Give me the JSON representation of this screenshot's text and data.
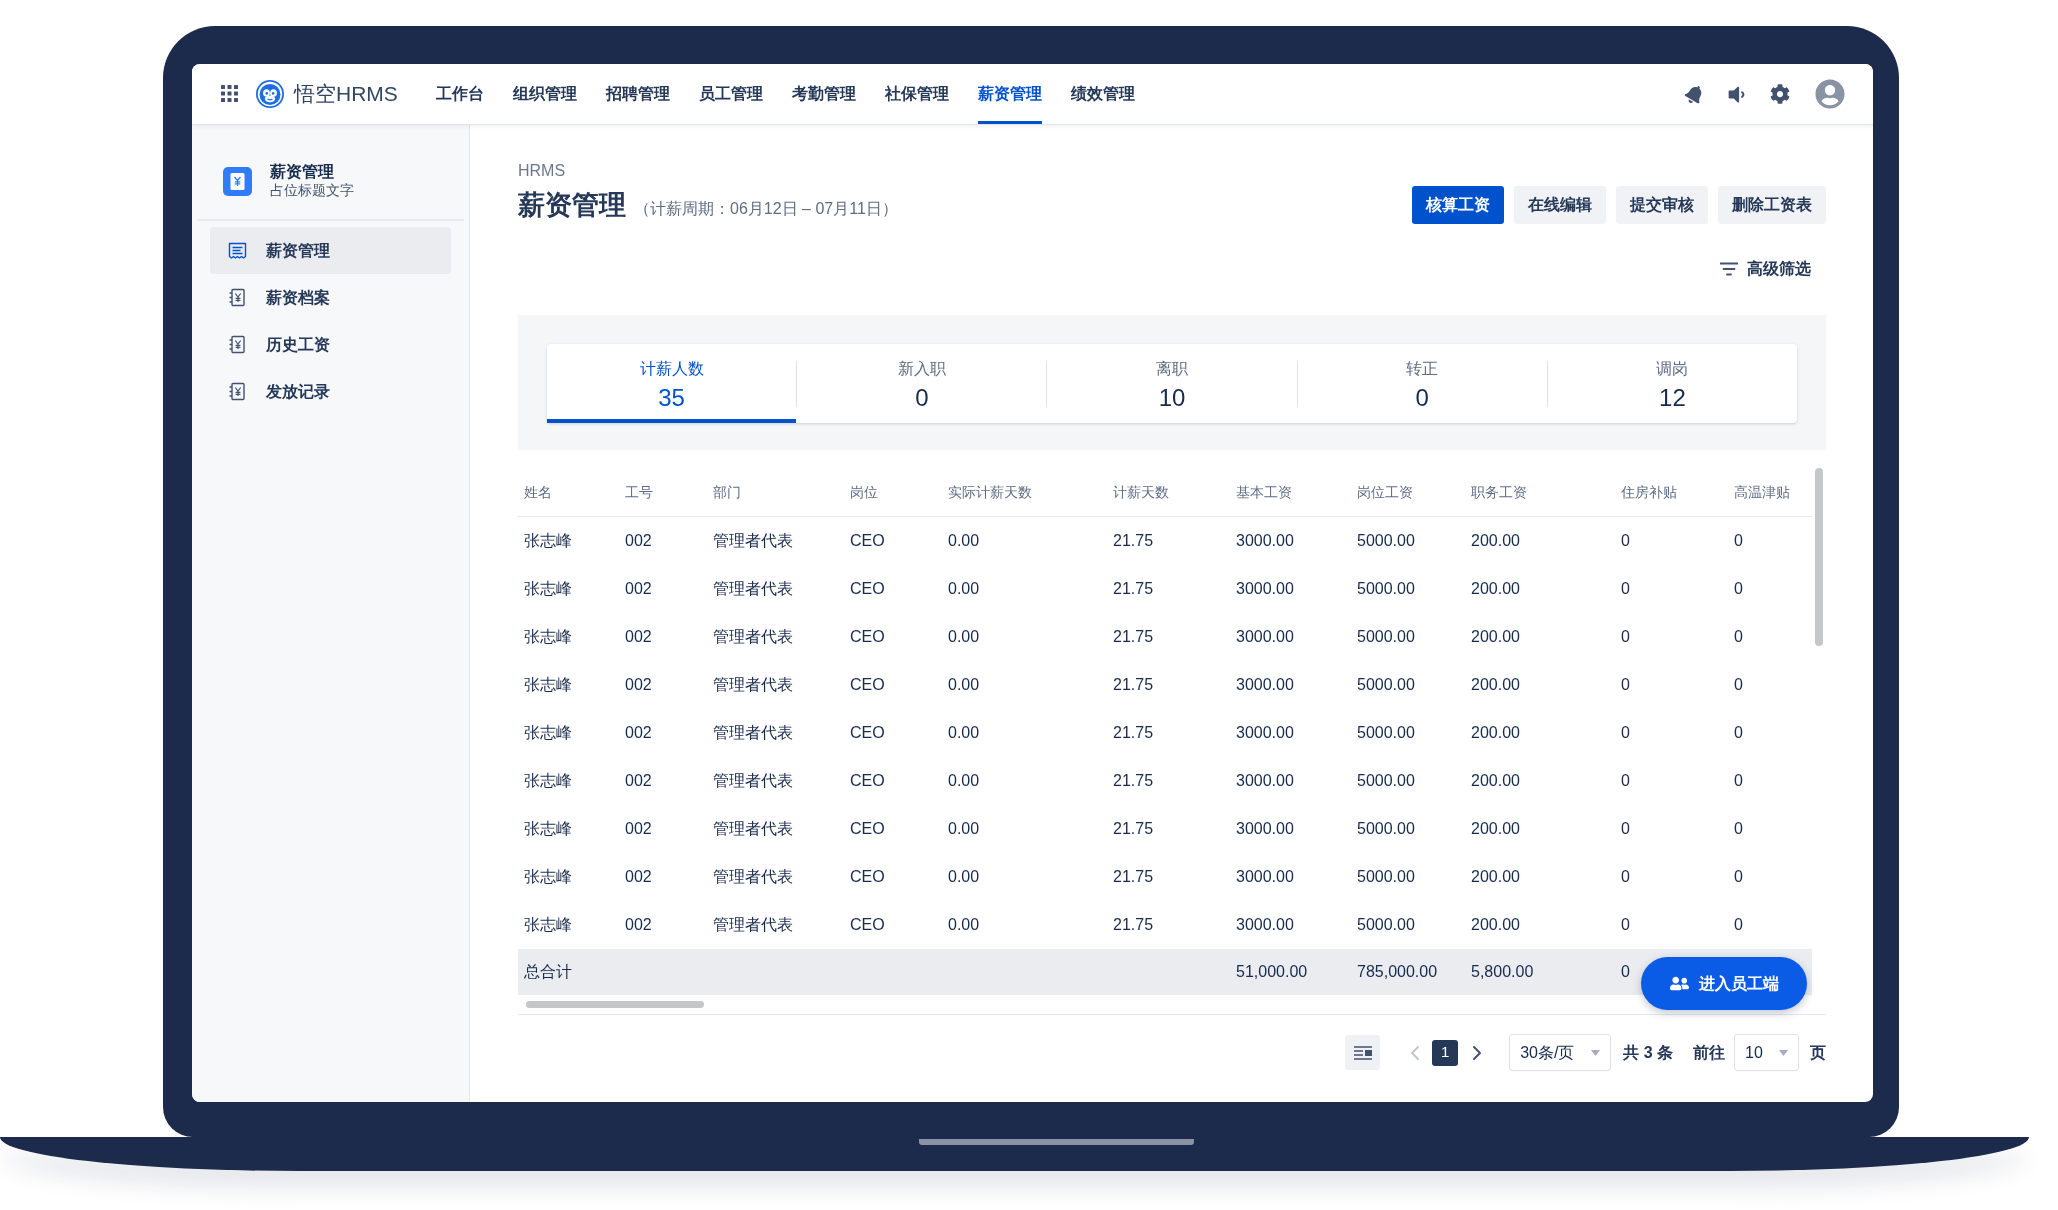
{
  "top_nav": {
    "brand": "悟空HRMS",
    "items": [
      {
        "label": "工作台",
        "selected": false
      },
      {
        "label": "组织管理",
        "selected": false
      },
      {
        "label": "招聘管理",
        "selected": false
      },
      {
        "label": "员工管理",
        "selected": false
      },
      {
        "label": "考勤管理",
        "selected": false
      },
      {
        "label": "社保管理",
        "selected": false
      },
      {
        "label": "薪资管理",
        "selected": true
      },
      {
        "label": "绩效管理",
        "selected": false
      }
    ]
  },
  "sidebar": {
    "title": "薪资管理",
    "subtitle": "占位标题文字",
    "items": [
      {
        "label": "薪资管理",
        "kind": "ledger",
        "selected": true
      },
      {
        "label": "薪资档案",
        "kind": "yen",
        "selected": false
      },
      {
        "label": "历史工资",
        "kind": "yen",
        "selected": false
      },
      {
        "label": "发放记录",
        "kind": "yen",
        "selected": false
      }
    ]
  },
  "page": {
    "breadcrumb": "HRMS",
    "title": "薪资管理",
    "period": "（计薪周期：06月12日 – 07月11日）",
    "actions": [
      {
        "label": "核算工资",
        "kind": "primary"
      },
      {
        "label": "在线编辑",
        "kind": "secondary"
      },
      {
        "label": "提交审核",
        "kind": "secondary"
      },
      {
        "label": "删除工资表",
        "kind": "secondary"
      }
    ],
    "filter": "高级筛选"
  },
  "stats": [
    {
      "label": "计薪人数",
      "value": "35",
      "selected": true
    },
    {
      "label": "新入职",
      "value": "0",
      "selected": false
    },
    {
      "label": "离职",
      "value": "10",
      "selected": false
    },
    {
      "label": "转正",
      "value": "0",
      "selected": false
    },
    {
      "label": "调岗",
      "value": "12",
      "selected": false
    }
  ],
  "table": {
    "columns": [
      "姓名",
      "工号",
      "部门",
      "岗位",
      "实际计薪天数",
      "计薪天数",
      "基本工资",
      "岗位工资",
      "职务工资",
      "住房补贴",
      "高温津贴"
    ],
    "rows": [
      [
        "张志峰",
        "002",
        "管理者代表",
        "CEO",
        "0.00",
        "21.75",
        "3000.00",
        "5000.00",
        "200.00",
        "0",
        "0"
      ],
      [
        "张志峰",
        "002",
        "管理者代表",
        "CEO",
        "0.00",
        "21.75",
        "3000.00",
        "5000.00",
        "200.00",
        "0",
        "0"
      ],
      [
        "张志峰",
        "002",
        "管理者代表",
        "CEO",
        "0.00",
        "21.75",
        "3000.00",
        "5000.00",
        "200.00",
        "0",
        "0"
      ],
      [
        "张志峰",
        "002",
        "管理者代表",
        "CEO",
        "0.00",
        "21.75",
        "3000.00",
        "5000.00",
        "200.00",
        "0",
        "0"
      ],
      [
        "张志峰",
        "002",
        "管理者代表",
        "CEO",
        "0.00",
        "21.75",
        "3000.00",
        "5000.00",
        "200.00",
        "0",
        "0"
      ],
      [
        "张志峰",
        "002",
        "管理者代表",
        "CEO",
        "0.00",
        "21.75",
        "3000.00",
        "5000.00",
        "200.00",
        "0",
        "0"
      ],
      [
        "张志峰",
        "002",
        "管理者代表",
        "CEO",
        "0.00",
        "21.75",
        "3000.00",
        "5000.00",
        "200.00",
        "0",
        "0"
      ],
      [
        "张志峰",
        "002",
        "管理者代表",
        "CEO",
        "0.00",
        "21.75",
        "3000.00",
        "5000.00",
        "200.00",
        "0",
        "0"
      ],
      [
        "张志峰",
        "002",
        "管理者代表",
        "CEO",
        "0.00",
        "21.75",
        "3000.00",
        "5000.00",
        "200.00",
        "0",
        "0"
      ]
    ],
    "total_row": {
      "label": "总合计",
      "base_salary": "51,000.00",
      "post_salary": "785,000.00",
      "duty_salary": "5,800.00",
      "housing_allowance": "0"
    }
  },
  "floating_button": {
    "label": "进入员工端"
  },
  "pagination": {
    "prev": {
      "disabled": true
    },
    "pages": [
      {
        "label": "1",
        "selected": true
      }
    ],
    "next": {
      "disabled": false
    },
    "page_size": "30条/页",
    "total": "共 3 条",
    "goto_label": "前往",
    "goto_value": "10",
    "goto_suffix": "页"
  }
}
